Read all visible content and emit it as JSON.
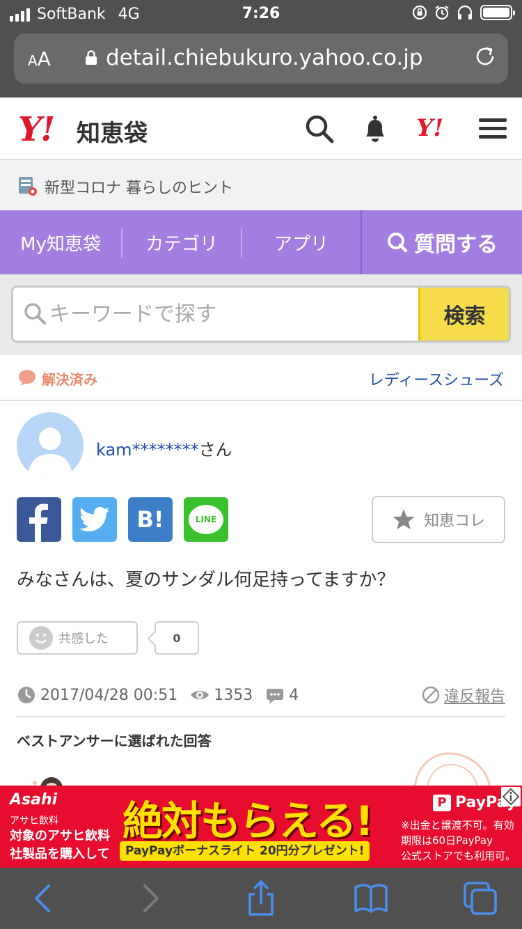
{
  "statusbar": {
    "carrier": "SoftBank",
    "network": "4G",
    "time": "7:26"
  },
  "browser": {
    "text_size_label": "AA",
    "url": "detail.chiebukuro.yahoo.co.jp"
  },
  "header": {
    "logo_mark": "Y!",
    "logo_text": "知恵袋",
    "yahoo_mark": "Y!",
    "icons": [
      "search-icon",
      "bell-icon",
      "yahoo-logo",
      "menu-icon"
    ]
  },
  "notice": {
    "text": "新型コロナ 暮らしのヒント"
  },
  "nav": {
    "items": [
      {
        "label": "My知恵袋"
      },
      {
        "label": "カテゴリ"
      },
      {
        "label": "アプリ"
      }
    ],
    "ask_label": "質問する"
  },
  "search": {
    "placeholder": "キーワードで探す",
    "button_label": "検索"
  },
  "question": {
    "status": "解決済み",
    "category": "レディースシューズ",
    "username": "kam********",
    "username_suffix": "さん",
    "share": {
      "hatena_label": "B!",
      "line_label": "LINE"
    },
    "chie_kore_label": "知恵コレ",
    "text": "みなさんは、夏のサンダル何足持ってますか？",
    "kyokan_label": "共感した",
    "kyokan_count": "0",
    "date": "2017/04/28 00:51",
    "views": "1353",
    "answers": "4",
    "report_label": "違反報告",
    "best_answer_title": "ベストアンサーに選ばれた回答"
  },
  "ad": {
    "brand": "Asahi",
    "brand_sub": "アサヒ飲料",
    "left_line1": "対象のアサヒ飲料",
    "left_line2": "社製品を購入して",
    "headline": "絶対もらえる!",
    "subline": "PayPayボーナスライト 20円分プレゼント!",
    "paypay_label": "PayPay",
    "right_line1": "※出金と譲渡不可。有効",
    "right_line2": "期限は60日PayPay",
    "right_line3": "公式ストアでも利用可。"
  },
  "colors": {
    "nav_purple": "#a47de0",
    "yahoo_red": "#e1182d",
    "search_yellow": "#f7dd4c",
    "link_blue": "#1f4ea8",
    "resolved_orange": "#e88a6a",
    "ios_blue": "#4a8ff0"
  }
}
